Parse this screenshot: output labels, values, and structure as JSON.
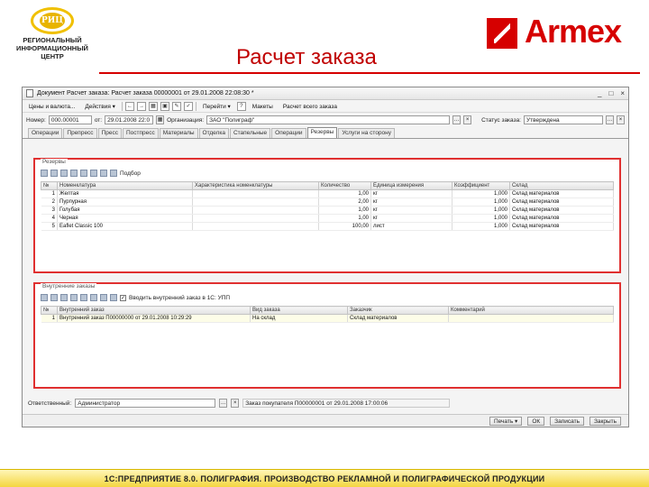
{
  "slide": {
    "logo_lines": [
      "РЕГИОНАЛЬНЫЙ",
      "ИНФОРМАЦИОННЫЙ",
      "ЦЕНТР"
    ],
    "logo_emblem": "РИЦ",
    "title": "Расчет заказа",
    "brand": "Armex",
    "footer": "1С:ПРЕДПРИЯТИЕ 8.0. ПОЛИГРАФИЯ. ПРОИЗВОДСТВО РЕКЛАМНОЙ И ПОЛИГРАФИЧЕСКОЙ ПРОДУКЦИИ"
  },
  "window": {
    "title": "Документ Расчет заказа: Расчет заказа 00000001 от 29.01.2008 22:08:30 *",
    "controls": [
      "_",
      "□",
      "×"
    ]
  },
  "toolbar": {
    "items": [
      "Цены и валюта...",
      "Действия ▾",
      "Перейти ▾",
      "Макеты",
      "Расчет всего заказа"
    ]
  },
  "fields": {
    "number_label": "Номер:",
    "number_value": "000.00001",
    "date_label": "от:",
    "date_value": "29.01.2008 22:0",
    "org_label": "Организация:",
    "org_value": "ЗАО \"Полиграф\"",
    "status_label": "Статус заказа:",
    "status_value": "Утверждена"
  },
  "tabs": [
    "Операции",
    "Препресс",
    "Пресс",
    "Постпресс",
    "Материалы",
    "Отделка",
    "Стапельные",
    "Операции",
    "Резервы",
    "Услуги на сторону"
  ],
  "active_tab_index": 8,
  "reserves": {
    "legend": "Резервы",
    "toolbar_label": "Подбор",
    "columns": [
      "№",
      "Номенклатура",
      "Характеристика номенклатуры",
      "Количество",
      "Единица измерения",
      "Коэффициент",
      "Склад"
    ],
    "rows": [
      {
        "n": "1",
        "item": "Желтая",
        "char": "",
        "qty": "1,00",
        "unit": "кг",
        "coef": "1,000",
        "store": "Склад материалов"
      },
      {
        "n": "2",
        "item": "Пурпурная",
        "char": "",
        "qty": "2,00",
        "unit": "кг",
        "coef": "1,000",
        "store": "Склад материалов"
      },
      {
        "n": "3",
        "item": "Голубая",
        "char": "",
        "qty": "1,00",
        "unit": "кг",
        "coef": "1,000",
        "store": "Склад материалов"
      },
      {
        "n": "4",
        "item": "Черная",
        "char": "",
        "qty": "1,00",
        "unit": "кг",
        "coef": "1,000",
        "store": "Склад материалов"
      },
      {
        "n": "5",
        "item": "Eaflet Classic 100",
        "char": "",
        "qty": "100,00",
        "unit": "лист",
        "coef": "1,000",
        "store": "Склад материалов"
      }
    ]
  },
  "internal_orders": {
    "legend": "Внутренние заказы",
    "checkbox_label": "Вводить внутренний заказ в 1С: УПП",
    "columns": [
      "№",
      "Внутренний заказ",
      "Вид заказа",
      "Заказчик",
      "Комментарий"
    ],
    "rows": [
      {
        "n": "1",
        "order": "Внутренний заказ П00000000 от 29.01.2008 10:29:29",
        "kind": "На склад",
        "customer": "Склад материалов",
        "comment": ""
      }
    ]
  },
  "bottom": {
    "responsible_label": "Ответственный:",
    "responsible_value": "Администратор",
    "order_ref": "Заказ покупателя П00000001 от 29.01.2008 17:00:06"
  },
  "footer_buttons": [
    "Печать ▾",
    "ОК",
    "Записать",
    "Закрыть"
  ]
}
